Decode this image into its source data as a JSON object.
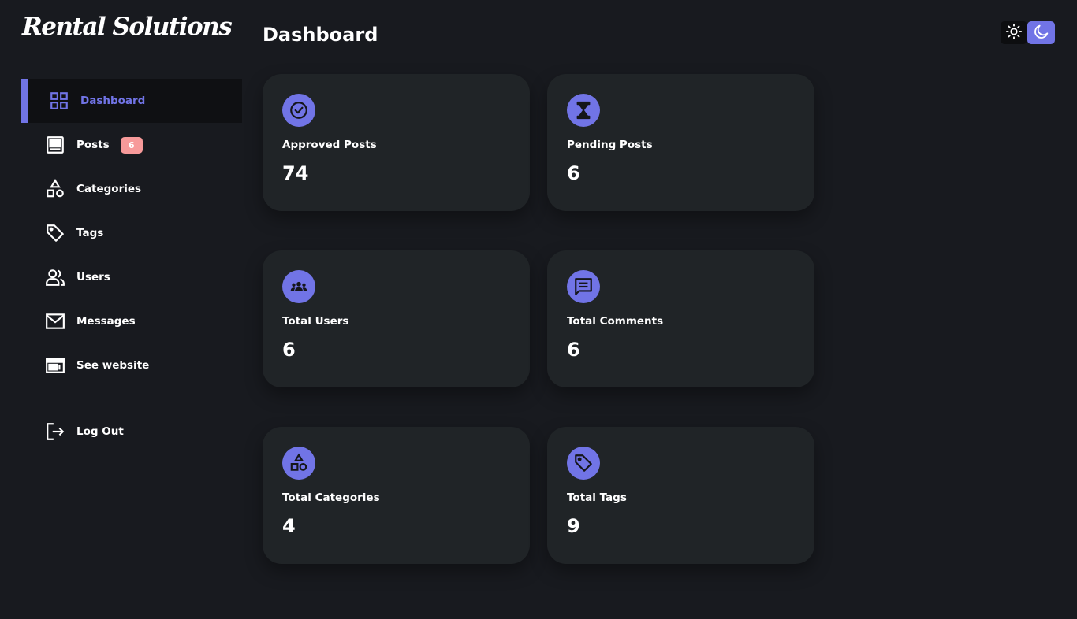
{
  "brand": {
    "logo_text": "Rental Solutions"
  },
  "header": {
    "title": "Dashboard"
  },
  "theme_toggle": {
    "light_icon": "sun-icon",
    "dark_icon": "moon-icon",
    "active": "dark"
  },
  "colors": {
    "accent": "#7174e6",
    "badge": "#f79a9a",
    "card_bg": "#202427",
    "page_bg": "#181a1f",
    "active_nav_bg": "#0f1013"
  },
  "sidebar": {
    "items": [
      {
        "label": "Dashboard",
        "icon": "dashboard-grid-icon",
        "active": true
      },
      {
        "label": "Posts",
        "icon": "posts-icon",
        "badge": "6"
      },
      {
        "label": "Categories",
        "icon": "shapes-icon"
      },
      {
        "label": "Tags",
        "icon": "tag-icon"
      },
      {
        "label": "Users",
        "icon": "users-icon"
      },
      {
        "label": "Messages",
        "icon": "mail-icon"
      },
      {
        "label": "See website",
        "icon": "website-icon"
      }
    ],
    "logout": {
      "label": "Log Out",
      "icon": "logout-icon"
    }
  },
  "cards": [
    {
      "label": "Approved Posts",
      "value": "74",
      "icon": "check-circle-icon"
    },
    {
      "label": "Pending Posts",
      "value": "6",
      "icon": "hourglass-icon"
    },
    {
      "label": "Total Users",
      "value": "6",
      "icon": "group-icon"
    },
    {
      "label": "Total Comments",
      "value": "6",
      "icon": "comment-icon"
    },
    {
      "label": "Total Categories",
      "value": "4",
      "icon": "shapes-icon"
    },
    {
      "label": "Total Tags",
      "value": "9",
      "icon": "tag-icon"
    }
  ]
}
